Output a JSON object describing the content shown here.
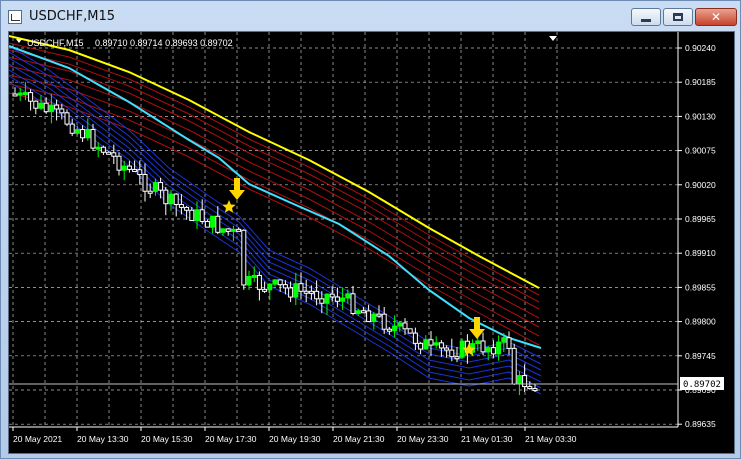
{
  "window": {
    "title": "USDCHF,M15",
    "close_glyph": "✕"
  },
  "chart_header": {
    "symbol_tf": "USDCHF,M15",
    "ohlc": "0.89710 0.89714 0.89693 0.89702"
  },
  "price_axis": {
    "ticks": [
      "0.90240",
      "0.90185",
      "0.90130",
      "0.90075",
      "0.90020",
      "0.89965",
      "0.89910",
      "0.89855",
      "0.89800",
      "0.89745",
      "0.89690",
      "0.89635"
    ],
    "current_price": "0.89702"
  },
  "time_axis": {
    "labels": [
      "20 May 2021",
      "20 May 13:30",
      "20 May 15:30",
      "20 May 17:30",
      "20 May 19:30",
      "20 May 21:30",
      "20 May 23:30",
      "21 May 01:30",
      "21 May 03:30"
    ]
  },
  "colors": {
    "background": "#000000",
    "grid": "#c0c0c0",
    "bull_candle": "#00ff00",
    "bear_candle": "#ffffff",
    "yellow_ma": "#ffff00",
    "cyan_ma": "#40e0ff",
    "red_ribbon": "#c01010",
    "blue_ribbon": "#1e3cff",
    "arrow": "#ffd700",
    "star": "#ffd700"
  },
  "icons": {
    "window": "chart-window-icon",
    "signal": "down-arrow-icon",
    "marker": "star-icon"
  }
}
